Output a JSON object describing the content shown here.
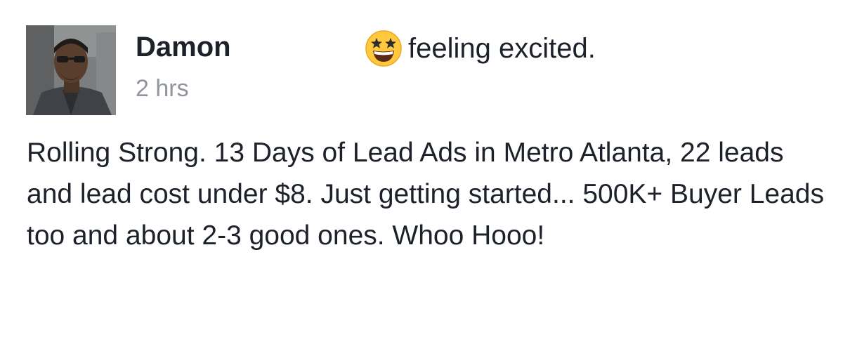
{
  "post": {
    "author": {
      "name": "Damon",
      "avatar_icon": "profile-photo"
    },
    "timestamp": "2 hrs",
    "feeling": {
      "icon": "star-struck-emoji-icon",
      "text": "feeling excited."
    },
    "body": "Rolling Strong. 13 Days of Lead Ads in Metro Atlanta, 22 leads and lead cost under $8. Just getting started... 500K+ Buyer Leads too and about 2-3 good ones. Whoo Hooo!"
  },
  "colors": {
    "text": "#1d2129",
    "secondary_text": "#90949c",
    "emoji_face": "#ffc83d"
  }
}
